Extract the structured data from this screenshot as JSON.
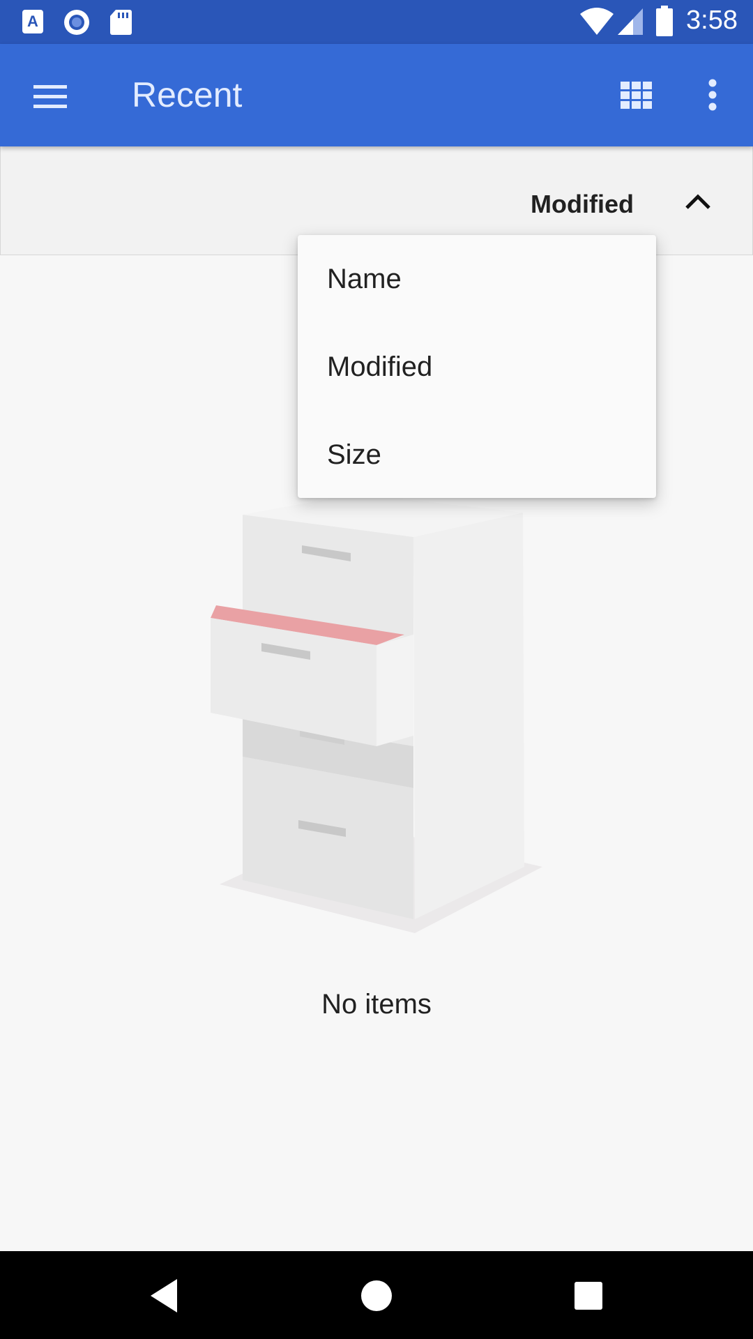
{
  "status_bar": {
    "time": "3:58",
    "icons": [
      "text-a-icon",
      "record-icon",
      "sd-card-icon",
      "wifi-icon",
      "signal-icon",
      "battery-icon"
    ]
  },
  "app_bar": {
    "title": "Recent",
    "icons": [
      "menu-icon",
      "grid-view-icon",
      "more-vert-icon"
    ],
    "color": "#356ad6"
  },
  "sort_bar": {
    "label": "Modified",
    "direction_icon": "chevron-up-icon"
  },
  "sort_menu": {
    "items": [
      {
        "label": "Name"
      },
      {
        "label": "Modified"
      },
      {
        "label": "Size"
      }
    ]
  },
  "empty_state": {
    "message": "No items",
    "illustration": "file-cabinet-illustration"
  },
  "nav_bar": {
    "icons": [
      "back-icon",
      "home-icon",
      "recents-icon"
    ]
  }
}
